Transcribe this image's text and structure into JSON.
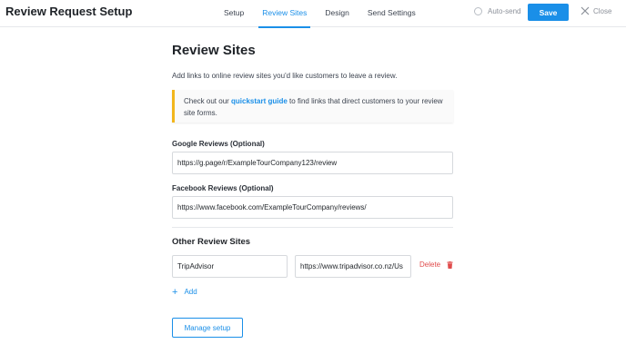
{
  "header": {
    "title": "Review Request Setup",
    "tabs": [
      {
        "label": "Setup",
        "active": false
      },
      {
        "label": "Review Sites",
        "active": true
      },
      {
        "label": "Design",
        "active": false
      },
      {
        "label": "Send Settings",
        "active": false
      }
    ],
    "autosend_label": "Auto-send",
    "autosend_checked": false,
    "save_label": "Save",
    "close_label": "Close"
  },
  "main": {
    "title": "Review Sites",
    "intro": "Add links to online review sites you'd like customers to leave a review.",
    "callout": {
      "before": "Check out our ",
      "link": "quickstart guide",
      "after": " to find links that direct customers to your review site forms."
    },
    "google": {
      "label": "Google Reviews (Optional)",
      "value": "https://g.page/r/ExampleTourCompany123/review"
    },
    "facebook": {
      "label": "Facebook Reviews (Optional)",
      "value": "https://www.facebook.com/ExampleTourCompany/reviews/"
    },
    "other": {
      "title": "Other Review Sites",
      "sites": [
        {
          "name": "TripAdvisor",
          "url": "https://www.tripadvisor.co.nz/Us"
        }
      ],
      "delete_label": "Delete",
      "add_label": "Add"
    },
    "manage_label": "Manage setup"
  },
  "colors": {
    "accent": "#1a8fe8",
    "danger": "#e04b4b",
    "callout_border": "#f2b61c"
  },
  "icons": [
    "x-close-icon",
    "trash-icon",
    "plus-icon",
    "radio-icon"
  ]
}
